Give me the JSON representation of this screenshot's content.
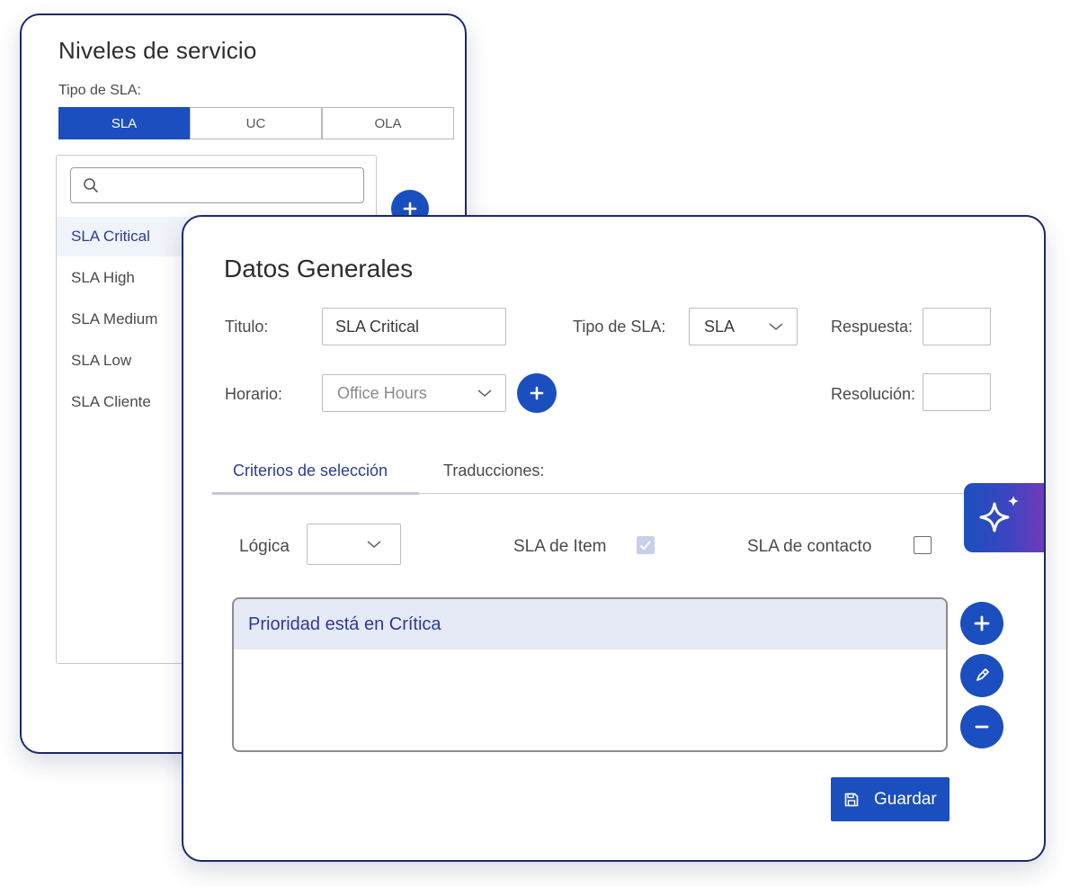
{
  "service_levels": {
    "title": "Niveles de servicio",
    "type_label": "Tipo de SLA:",
    "segments": [
      "SLA",
      "UC",
      "OLA"
    ],
    "active_segment": "SLA",
    "search": {
      "placeholder": "",
      "icon": "search-icon"
    },
    "add_icon": "plus-icon",
    "items": [
      "SLA Critical",
      "SLA High",
      "SLA Medium",
      "SLA Low",
      "SLA Cliente"
    ],
    "selected_item": "SLA Critical"
  },
  "general_data": {
    "title": "Datos Generales",
    "titulo_label": "Titulo:",
    "titulo_value": "SLA Critical",
    "tipo_label": "Tipo de SLA:",
    "tipo_value": "SLA",
    "respuesta_label": "Respuesta:",
    "respuesta_value": "",
    "horario_label": "Horario:",
    "horario_value": "Office Hours",
    "resolucion_label": "Resolución:",
    "resolucion_value": "",
    "tabs": [
      "Criterios de selección",
      "Traducciones:"
    ],
    "active_tab": "Criterios de selección",
    "logica_label": "Lógica",
    "logica_value": "",
    "sla_item_label": "SLA de Item",
    "sla_item_checked": true,
    "sla_contacto_label": "SLA de contacto",
    "sla_contacto_checked": false,
    "criteria": [
      "Prioridad está en Crítica"
    ],
    "action_icons": [
      "plus-icon",
      "pencil-icon",
      "minus-icon"
    ],
    "save_label": "Guardar",
    "save_icon": "floppy-disk-icon"
  },
  "assistant": {
    "icon": "sparkle-icon"
  },
  "colors": {
    "primary": "#1b4fbf",
    "border": "#1d2a6b",
    "selected_text": "#2a3d93",
    "criteria_bg": "#e6e9f6",
    "ai_gradient_end": "#6f3aba"
  }
}
